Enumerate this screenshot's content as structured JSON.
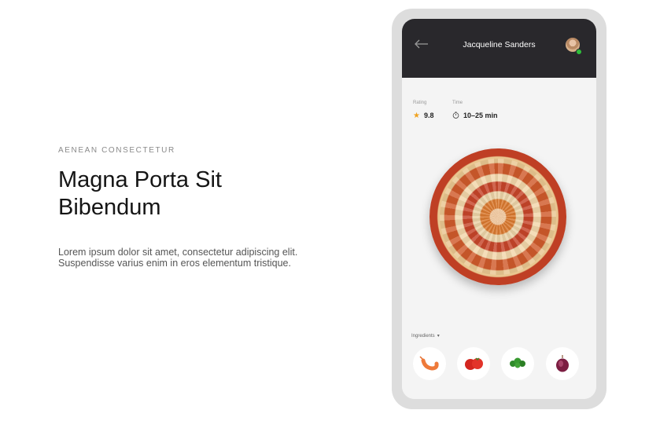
{
  "hero": {
    "eyebrow": "AENEAN CONSECTETUR",
    "title": "Magna Porta Sit Bibendum",
    "body": "Lorem ipsum dolor sit amet, consectetur adipiscing elit. Suspendisse varius enim in eros elementum tristique."
  },
  "app": {
    "header": {
      "back_icon": "arrow-left-icon",
      "user_name": "Jacqueline Sanders",
      "avatar_status_color": "#2fbf3b"
    },
    "stats": {
      "rating_label": "Rating",
      "rating_value": "9.8",
      "time_label": "Time",
      "time_value": "10–25 min"
    },
    "ingredients": {
      "label": "Ingredients",
      "items": [
        "shrimp",
        "tomato",
        "parsley",
        "red onion"
      ]
    },
    "colors": {
      "topbar": "#29282c",
      "star": "#f0a21e",
      "background": "#f4f4f4"
    }
  }
}
